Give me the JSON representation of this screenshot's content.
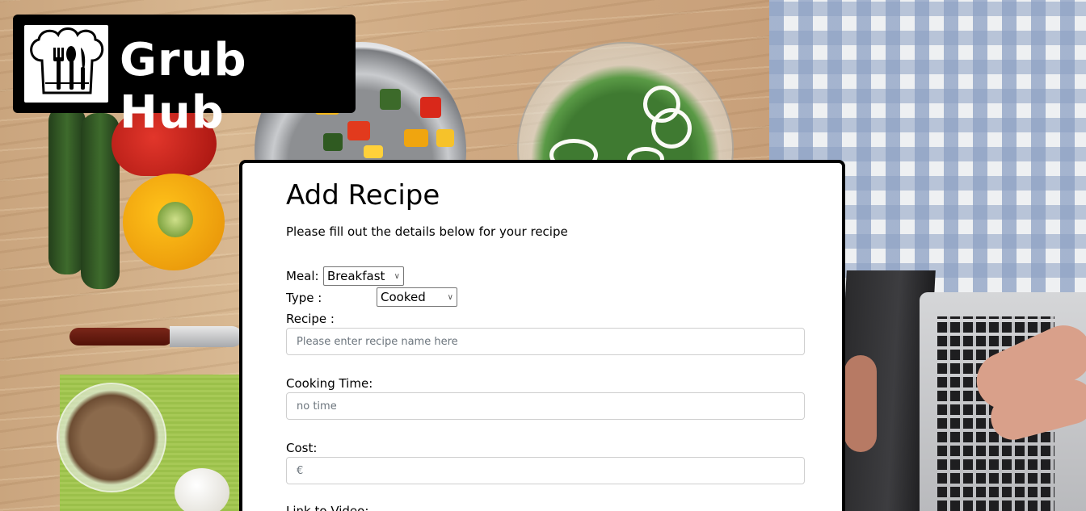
{
  "logo": {
    "text": "Grub Hub"
  },
  "form": {
    "title": "Add Recipe",
    "subtitle": "Please fill out the details below for your recipe",
    "meal": {
      "label": "Meal:",
      "value": "Breakfast"
    },
    "type": {
      "label": "Type :",
      "value": "Cooked"
    },
    "recipe": {
      "label": "Recipe :",
      "placeholder": "Please enter recipe name here"
    },
    "cooking_time": {
      "label": "Cooking Time:",
      "placeholder": "no time"
    },
    "cost": {
      "label": "Cost:",
      "placeholder": "€"
    },
    "link_to_video": {
      "label": "Link to Video:"
    }
  }
}
